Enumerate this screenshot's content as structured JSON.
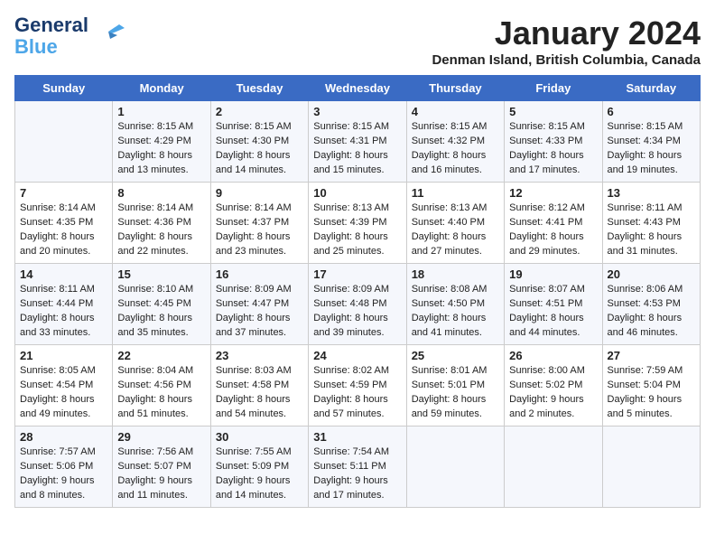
{
  "header": {
    "logo_line1": "General",
    "logo_line2": "Blue",
    "month_title": "January 2024",
    "location": "Denman Island, British Columbia, Canada"
  },
  "days_of_week": [
    "Sunday",
    "Monday",
    "Tuesday",
    "Wednesday",
    "Thursday",
    "Friday",
    "Saturday"
  ],
  "weeks": [
    [
      {
        "num": "",
        "sunrise": "",
        "sunset": "",
        "daylight": ""
      },
      {
        "num": "1",
        "sunrise": "Sunrise: 8:15 AM",
        "sunset": "Sunset: 4:29 PM",
        "daylight": "Daylight: 8 hours and 13 minutes."
      },
      {
        "num": "2",
        "sunrise": "Sunrise: 8:15 AM",
        "sunset": "Sunset: 4:30 PM",
        "daylight": "Daylight: 8 hours and 14 minutes."
      },
      {
        "num": "3",
        "sunrise": "Sunrise: 8:15 AM",
        "sunset": "Sunset: 4:31 PM",
        "daylight": "Daylight: 8 hours and 15 minutes."
      },
      {
        "num": "4",
        "sunrise": "Sunrise: 8:15 AM",
        "sunset": "Sunset: 4:32 PM",
        "daylight": "Daylight: 8 hours and 16 minutes."
      },
      {
        "num": "5",
        "sunrise": "Sunrise: 8:15 AM",
        "sunset": "Sunset: 4:33 PM",
        "daylight": "Daylight: 8 hours and 17 minutes."
      },
      {
        "num": "6",
        "sunrise": "Sunrise: 8:15 AM",
        "sunset": "Sunset: 4:34 PM",
        "daylight": "Daylight: 8 hours and 19 minutes."
      }
    ],
    [
      {
        "num": "7",
        "sunrise": "Sunrise: 8:14 AM",
        "sunset": "Sunset: 4:35 PM",
        "daylight": "Daylight: 8 hours and 20 minutes."
      },
      {
        "num": "8",
        "sunrise": "Sunrise: 8:14 AM",
        "sunset": "Sunset: 4:36 PM",
        "daylight": "Daylight: 8 hours and 22 minutes."
      },
      {
        "num": "9",
        "sunrise": "Sunrise: 8:14 AM",
        "sunset": "Sunset: 4:37 PM",
        "daylight": "Daylight: 8 hours and 23 minutes."
      },
      {
        "num": "10",
        "sunrise": "Sunrise: 8:13 AM",
        "sunset": "Sunset: 4:39 PM",
        "daylight": "Daylight: 8 hours and 25 minutes."
      },
      {
        "num": "11",
        "sunrise": "Sunrise: 8:13 AM",
        "sunset": "Sunset: 4:40 PM",
        "daylight": "Daylight: 8 hours and 27 minutes."
      },
      {
        "num": "12",
        "sunrise": "Sunrise: 8:12 AM",
        "sunset": "Sunset: 4:41 PM",
        "daylight": "Daylight: 8 hours and 29 minutes."
      },
      {
        "num": "13",
        "sunrise": "Sunrise: 8:11 AM",
        "sunset": "Sunset: 4:43 PM",
        "daylight": "Daylight: 8 hours and 31 minutes."
      }
    ],
    [
      {
        "num": "14",
        "sunrise": "Sunrise: 8:11 AM",
        "sunset": "Sunset: 4:44 PM",
        "daylight": "Daylight: 8 hours and 33 minutes."
      },
      {
        "num": "15",
        "sunrise": "Sunrise: 8:10 AM",
        "sunset": "Sunset: 4:45 PM",
        "daylight": "Daylight: 8 hours and 35 minutes."
      },
      {
        "num": "16",
        "sunrise": "Sunrise: 8:09 AM",
        "sunset": "Sunset: 4:47 PM",
        "daylight": "Daylight: 8 hours and 37 minutes."
      },
      {
        "num": "17",
        "sunrise": "Sunrise: 8:09 AM",
        "sunset": "Sunset: 4:48 PM",
        "daylight": "Daylight: 8 hours and 39 minutes."
      },
      {
        "num": "18",
        "sunrise": "Sunrise: 8:08 AM",
        "sunset": "Sunset: 4:50 PM",
        "daylight": "Daylight: 8 hours and 41 minutes."
      },
      {
        "num": "19",
        "sunrise": "Sunrise: 8:07 AM",
        "sunset": "Sunset: 4:51 PM",
        "daylight": "Daylight: 8 hours and 44 minutes."
      },
      {
        "num": "20",
        "sunrise": "Sunrise: 8:06 AM",
        "sunset": "Sunset: 4:53 PM",
        "daylight": "Daylight: 8 hours and 46 minutes."
      }
    ],
    [
      {
        "num": "21",
        "sunrise": "Sunrise: 8:05 AM",
        "sunset": "Sunset: 4:54 PM",
        "daylight": "Daylight: 8 hours and 49 minutes."
      },
      {
        "num": "22",
        "sunrise": "Sunrise: 8:04 AM",
        "sunset": "Sunset: 4:56 PM",
        "daylight": "Daylight: 8 hours and 51 minutes."
      },
      {
        "num": "23",
        "sunrise": "Sunrise: 8:03 AM",
        "sunset": "Sunset: 4:58 PM",
        "daylight": "Daylight: 8 hours and 54 minutes."
      },
      {
        "num": "24",
        "sunrise": "Sunrise: 8:02 AM",
        "sunset": "Sunset: 4:59 PM",
        "daylight": "Daylight: 8 hours and 57 minutes."
      },
      {
        "num": "25",
        "sunrise": "Sunrise: 8:01 AM",
        "sunset": "Sunset: 5:01 PM",
        "daylight": "Daylight: 8 hours and 59 minutes."
      },
      {
        "num": "26",
        "sunrise": "Sunrise: 8:00 AM",
        "sunset": "Sunset: 5:02 PM",
        "daylight": "Daylight: 9 hours and 2 minutes."
      },
      {
        "num": "27",
        "sunrise": "Sunrise: 7:59 AM",
        "sunset": "Sunset: 5:04 PM",
        "daylight": "Daylight: 9 hours and 5 minutes."
      }
    ],
    [
      {
        "num": "28",
        "sunrise": "Sunrise: 7:57 AM",
        "sunset": "Sunset: 5:06 PM",
        "daylight": "Daylight: 9 hours and 8 minutes."
      },
      {
        "num": "29",
        "sunrise": "Sunrise: 7:56 AM",
        "sunset": "Sunset: 5:07 PM",
        "daylight": "Daylight: 9 hours and 11 minutes."
      },
      {
        "num": "30",
        "sunrise": "Sunrise: 7:55 AM",
        "sunset": "Sunset: 5:09 PM",
        "daylight": "Daylight: 9 hours and 14 minutes."
      },
      {
        "num": "31",
        "sunrise": "Sunrise: 7:54 AM",
        "sunset": "Sunset: 5:11 PM",
        "daylight": "Daylight: 9 hours and 17 minutes."
      },
      {
        "num": "",
        "sunrise": "",
        "sunset": "",
        "daylight": ""
      },
      {
        "num": "",
        "sunrise": "",
        "sunset": "",
        "daylight": ""
      },
      {
        "num": "",
        "sunrise": "",
        "sunset": "",
        "daylight": ""
      }
    ]
  ]
}
